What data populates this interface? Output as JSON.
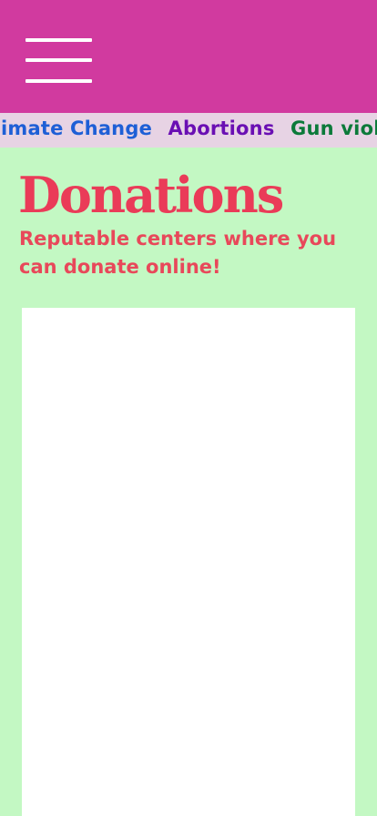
{
  "header": {
    "menu_icon": "hamburger-menu-icon",
    "background_color": "#d13a9f"
  },
  "ticker": {
    "items": [
      {
        "label": "Climate Change",
        "color": "#1e5fd6"
      },
      {
        "label": "Abortions",
        "color": "#6a0fb3"
      },
      {
        "label": "Gun violence",
        "color": "#0c7a3a"
      }
    ]
  },
  "main": {
    "title": "Donations",
    "subtitle": "Reputable centers where you can donate online!",
    "title_color": "#ea3b58",
    "background_color": "#c3f8c3"
  }
}
